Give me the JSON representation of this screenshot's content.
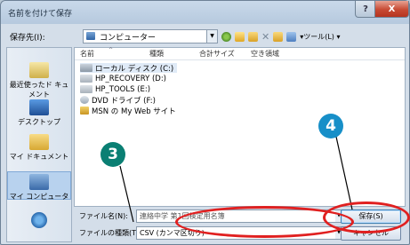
{
  "dialog": {
    "title": "名前を付けて保存",
    "help_label": "?",
    "close_label": "X"
  },
  "location": {
    "label": "保存先(I):",
    "value": "コンピューター",
    "icon": "computer-icon"
  },
  "toolbar": {
    "tools_label": "ツール(L)"
  },
  "places": [
    {
      "label": "最近使ったド キュメント",
      "icon": "recent-documents-icon"
    },
    {
      "label": "デスクトップ",
      "icon": "desktop-icon"
    },
    {
      "label": "マイ ドキュメント",
      "icon": "my-documents-icon"
    },
    {
      "label": "マイ コンピュータ",
      "icon": "my-computer-icon",
      "active": true
    },
    {
      "label": "",
      "icon": "network-icon"
    }
  ],
  "columns": [
    "名前",
    "種類",
    "合計サイズ",
    "空き領域"
  ],
  "items": [
    {
      "label": "ローカル ディスク (C:)",
      "icon": "local-disk-icon",
      "selected": true
    },
    {
      "label": "HP_RECOVERY (D:)",
      "icon": "drive-icon"
    },
    {
      "label": "HP_TOOLS (E:)",
      "icon": "drive-icon"
    },
    {
      "label": "DVD ドライブ (F:)",
      "icon": "dvd-drive-icon"
    },
    {
      "label": "MSN の My Web サイト",
      "icon": "msn-icon"
    }
  ],
  "filename": {
    "label": "ファイル名(N):",
    "value": "連絡中学 第1回検定用名簿"
  },
  "filetype": {
    "label": "ファイルの種類(T):",
    "value": "CSV (カンマ区切り)"
  },
  "buttons": {
    "save": "保存(S)",
    "cancel": "キャンセル"
  },
  "callouts": {
    "badge3": "3",
    "badge4": "4"
  },
  "colors": {
    "highlight_ring": "#e02020",
    "badge3": "#0a7f73",
    "badge4": "#178fc8"
  }
}
